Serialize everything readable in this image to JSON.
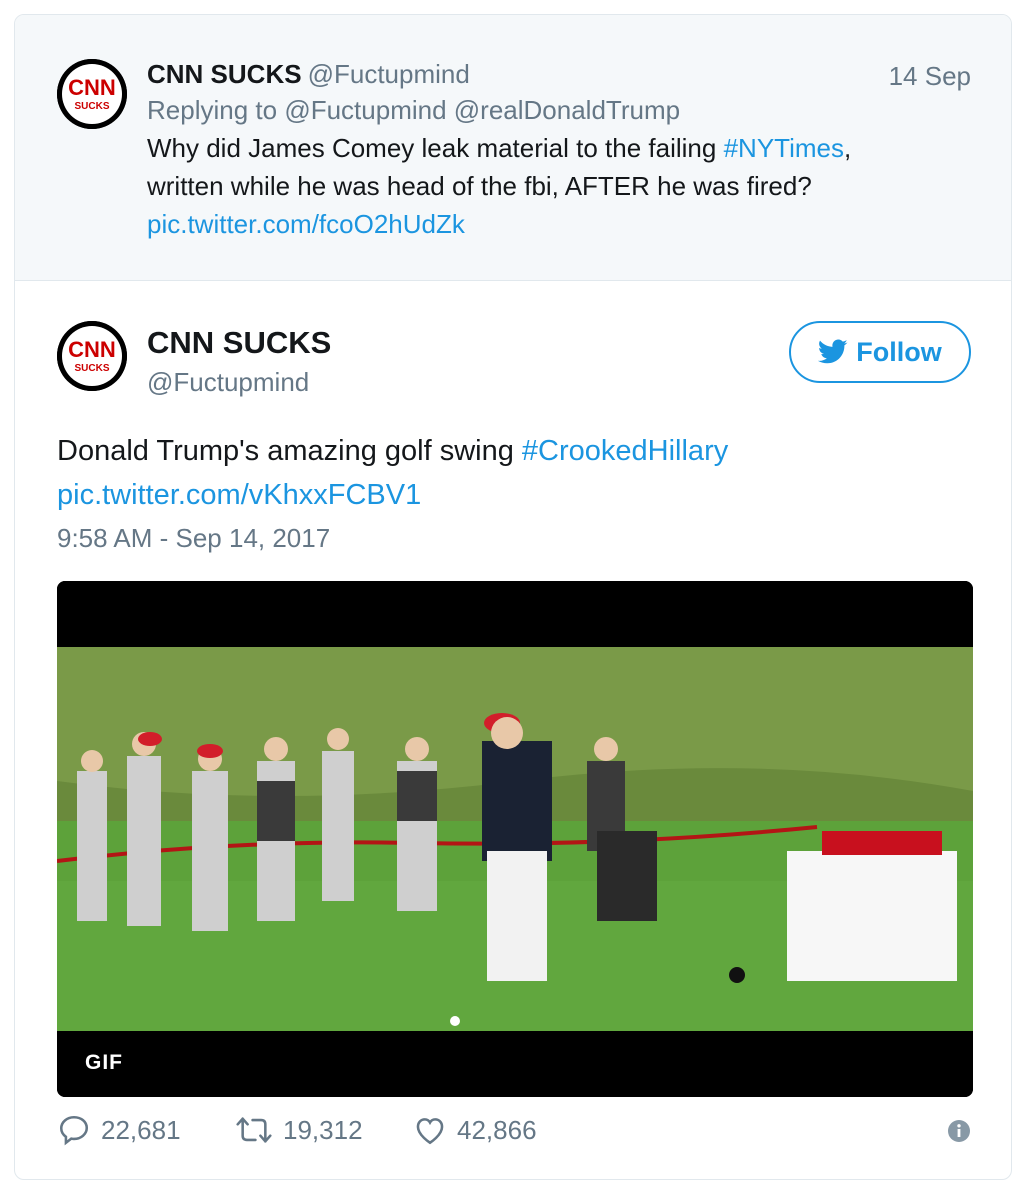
{
  "parent_tweet": {
    "display_name": "CNN SUCKS",
    "handle": "@Fuctupmind",
    "date": "14 Sep",
    "reply_prefix": "Replying to",
    "reply_to_1": "@Fuctupmind",
    "reply_to_2": "@realDonaldTrump",
    "text_1": "Why did James Comey leak material to the failing ",
    "hashtag": "#NYTimes",
    "text_2": ",",
    "text_3": "written while he was head of the fbi, AFTER he was fired?",
    "pic_link": "pic.twitter.com/fcoO2hUdZk"
  },
  "main_tweet": {
    "display_name": "CNN SUCKS",
    "handle": "@Fuctupmind",
    "follow_label": "Follow",
    "text": "Donald Trump's amazing golf swing ",
    "hashtag": "#CrookedHillary",
    "pic_link": "pic.twitter.com/vKhxxFCBV1",
    "timestamp": "9:58 AM - Sep 14, 2017",
    "media_badge": "GIF",
    "replies": "22,681",
    "retweets": "19,312",
    "likes": "42,866"
  },
  "avatar_text": {
    "top": "CNN",
    "bottom": "SUCKS"
  },
  "colors": {
    "link": "#1b95e0",
    "muted": "#657786",
    "parent_bg": "#f5f8fa",
    "grass": "#5da23a"
  }
}
